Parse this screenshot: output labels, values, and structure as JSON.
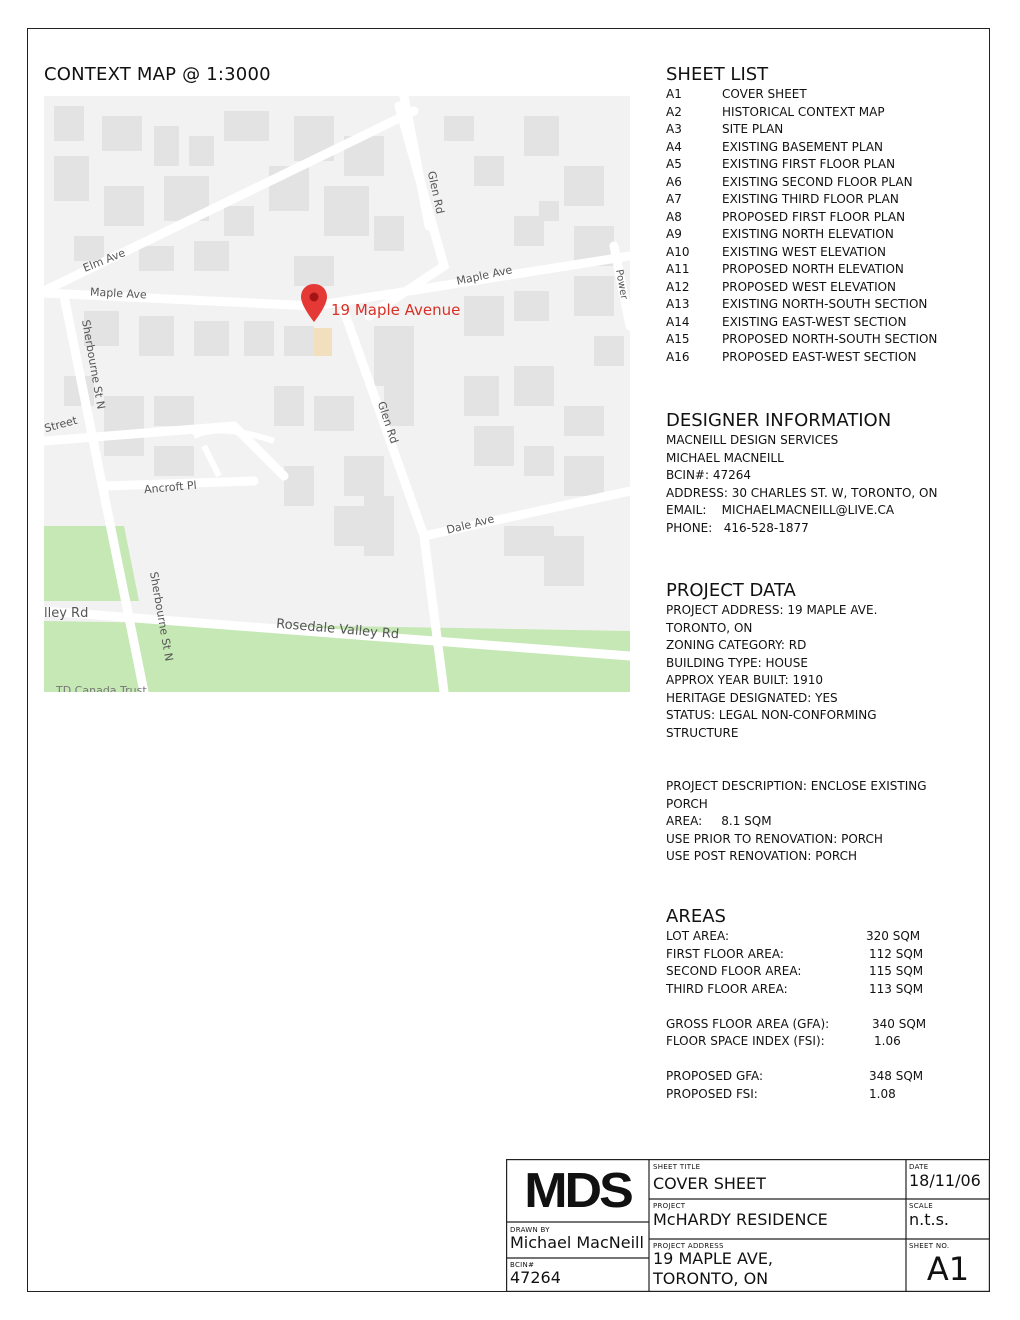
{
  "map": {
    "title": "CONTEXT MAP @ 1:3000",
    "pin_label": "19 Maple Avenue",
    "streets": {
      "elm_ave": "Elm Ave",
      "maple_ave_west": "Maple Ave",
      "maple_ave_east": "Maple Ave",
      "glen_rd_north": "Glen Rd",
      "glen_rd_south": "Glen Rd",
      "sherbourne_north": "Sherbourne St N",
      "sherbourne_south": "Sherbourne St N",
      "street_west": "Street",
      "ancroft": "Ancroft Pl",
      "dale_ave": "Dale Ave",
      "valley_rd_west": "lley Rd",
      "rosedale_valley": "Rosedale Valley Rd",
      "power": "Power",
      "td_canada": "TD Canada Trust"
    }
  },
  "sheet_list": {
    "title": "SHEET LIST",
    "items": [
      {
        "no": "A1",
        "name": "COVER SHEET"
      },
      {
        "no": "A2",
        "name": "HISTORICAL CONTEXT MAP"
      },
      {
        "no": "A3",
        "name": "SITE PLAN"
      },
      {
        "no": "A4",
        "name": "EXISTING BASEMENT PLAN"
      },
      {
        "no": "A5",
        "name": "EXISTING FIRST FLOOR PLAN"
      },
      {
        "no": "A6",
        "name": "EXISTING SECOND FLOOR PLAN"
      },
      {
        "no": "A7",
        "name": "EXISTING THIRD FLOOR PLAN"
      },
      {
        "no": "A8",
        "name": "PROPOSED FIRST FLOOR PLAN"
      },
      {
        "no": "A9",
        "name": "EXISTING NORTH ELEVATION"
      },
      {
        "no": "A10",
        "name": "EXISTING WEST ELEVATION"
      },
      {
        "no": "A11",
        "name": "PROPOSED NORTH ELEVATION"
      },
      {
        "no": "A12",
        "name": "PROPOSED WEST ELEVATION"
      },
      {
        "no": "A13",
        "name": "EXISTING NORTH-SOUTH SECTION"
      },
      {
        "no": "A14",
        "name": "EXISTING EAST-WEST SECTION"
      },
      {
        "no": "A15",
        "name": "PROPOSED NORTH-SOUTH SECTION"
      },
      {
        "no": "A16",
        "name": "PROPOSED EAST-WEST SECTION"
      }
    ]
  },
  "designer": {
    "title": "DESIGNER INFORMATION",
    "lines": [
      "MACNEILL DESIGN SERVICES",
      "MICHAEL MACNEILL",
      "BCIN#: 47264",
      "ADDRESS: 30 CHARLES ST. W, TORONTO, ON",
      "EMAIL:    MICHAELMACNEILL@LIVE.CA",
      "PHONE:   416-528-1877"
    ]
  },
  "project_data": {
    "title": "PROJECT DATA",
    "lines": [
      "PROJECT ADDRESS: 19 MAPLE AVE.",
      "TORONTO, ON",
      "ZONING CATEGORY: RD",
      "BUILDING TYPE: HOUSE",
      "APPROX YEAR BUILT: 1910",
      "HERITAGE DESIGNATED: YES",
      "STATUS: LEGAL NON-CONFORMING",
      "STRUCTURE"
    ],
    "desc_lines": [
      "PROJECT DESCRIPTION: ENCLOSE EXISTING",
      "PORCH",
      "AREA:     8.1 SQM",
      "USE PRIOR TO RENOVATION: PORCH",
      "USE POST RENOVATION: PORCH"
    ]
  },
  "areas": {
    "title": "AREAS",
    "group1": [
      {
        "label": "LOT AREA:",
        "value": "320 SQM"
      },
      {
        "label": "FIRST FLOOR AREA:",
        "value": "112 SQM"
      },
      {
        "label": "SECOND FLOOR AREA:",
        "value": "115 SQM"
      },
      {
        "label": "THIRD FLOOR AREA:",
        "value": "113 SQM"
      }
    ],
    "group2": [
      {
        "label": "GROSS FLOOR AREA (GFA):",
        "value": "340 SQM"
      },
      {
        "label": "FLOOR SPACE INDEX (FSI):",
        "value": "1.06"
      }
    ],
    "group3": [
      {
        "label": "PROPOSED GFA:",
        "value": "348 SQM"
      },
      {
        "label": "PROPOSED FSI:",
        "value": "1.08"
      }
    ]
  },
  "title_block": {
    "logo": "MDS",
    "drawn_by_label": "DRAWN  BY",
    "drawn_by": "Michael MacNeill",
    "bcin_label": "BCIN#",
    "bcin": "47264",
    "sheet_title_label": "SHEET  TITLE",
    "sheet_title": "COVER SHEET",
    "project_label": "PROJECT",
    "project": "McHARDY RESIDENCE",
    "address_label": "PROJECT  ADDRESS",
    "address_1": "19 MAPLE AVE,",
    "address_2": "TORONTO, ON",
    "date_label": "DATE",
    "date": "18/11/06",
    "scale_label": "SCALE",
    "scale": "n.t.s.",
    "sheet_no_label": "SHEET  NO.",
    "sheet_no": "A1"
  }
}
